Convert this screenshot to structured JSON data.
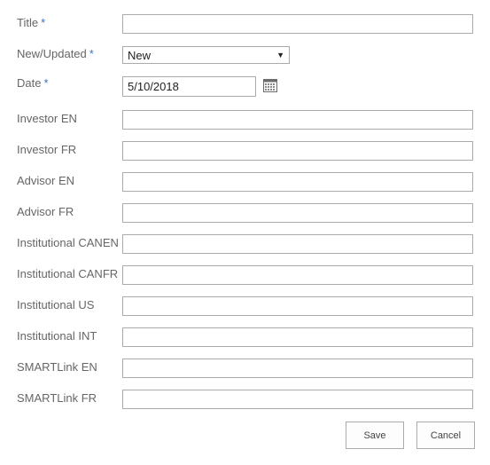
{
  "form": {
    "fields": [
      {
        "key": "title",
        "label": "Title",
        "required": true,
        "required_mark": "*",
        "value": ""
      },
      {
        "key": "new_updated",
        "label": "New/Updated",
        "required": true,
        "required_mark": "*",
        "value": "New",
        "options": [
          "New"
        ]
      },
      {
        "key": "date",
        "label": "Date",
        "required": true,
        "required_mark": "*",
        "value": "5/10/2018"
      },
      {
        "key": "investor_en",
        "label": "Investor EN",
        "required": false,
        "value": ""
      },
      {
        "key": "investor_fr",
        "label": "Investor FR",
        "required": false,
        "value": ""
      },
      {
        "key": "advisor_en",
        "label": "Advisor EN",
        "required": false,
        "value": ""
      },
      {
        "key": "advisor_fr",
        "label": "Advisor FR",
        "required": false,
        "value": ""
      },
      {
        "key": "institutional_canen",
        "label": "Institutional CANEN",
        "required": false,
        "value": ""
      },
      {
        "key": "institutional_canfr",
        "label": "Institutional CANFR",
        "required": false,
        "value": ""
      },
      {
        "key": "institutional_us",
        "label": "Institutional US",
        "required": false,
        "value": ""
      },
      {
        "key": "institutional_int",
        "label": "Institutional INT",
        "required": false,
        "value": ""
      },
      {
        "key": "smartlink_en",
        "label": "SMARTLink EN",
        "required": false,
        "value": ""
      },
      {
        "key": "smartlink_fr",
        "label": "SMARTLink FR",
        "required": false,
        "value": ""
      }
    ],
    "calendar_icon": "calendar-icon",
    "dropdown_icon": "triangle-down-icon"
  },
  "buttons": {
    "save_label": "Save",
    "cancel_label": "Cancel"
  },
  "colors": {
    "label": "#666666",
    "required_mark": "#3b73b9",
    "border": "#ababab"
  }
}
